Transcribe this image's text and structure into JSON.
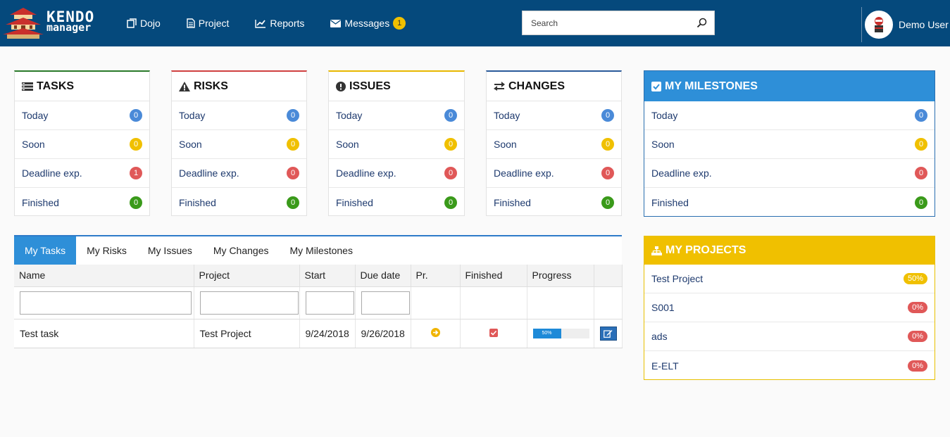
{
  "brand": {
    "line1": "KENDO",
    "line2": "manager"
  },
  "nav": [
    {
      "label": "Dojo",
      "icon": "dojo-icon"
    },
    {
      "label": "Project",
      "icon": "document-icon"
    },
    {
      "label": "Reports",
      "icon": "chart-line-icon"
    },
    {
      "label": "Messages",
      "icon": "envelope-icon",
      "badge": "1"
    }
  ],
  "search": {
    "placeholder": "Search",
    "value": ""
  },
  "user": {
    "name": "Demo User"
  },
  "cards": [
    {
      "title": "TASKS",
      "icon": "tasks-icon",
      "accent": "#2a7a2a",
      "rows": [
        {
          "label": "Today",
          "count": "0",
          "color": "blue"
        },
        {
          "label": "Soon",
          "count": "0",
          "color": "yellow"
        },
        {
          "label": "Deadline exp.",
          "count": "1",
          "color": "red"
        },
        {
          "label": "Finished",
          "count": "0",
          "color": "green"
        }
      ]
    },
    {
      "title": "RISKS",
      "icon": "warning-icon",
      "accent": "#d04040",
      "rows": [
        {
          "label": "Today",
          "count": "0",
          "color": "blue"
        },
        {
          "label": "Soon",
          "count": "0",
          "color": "yellow"
        },
        {
          "label": "Deadline exp.",
          "count": "0",
          "color": "red"
        },
        {
          "label": "Finished",
          "count": "0",
          "color": "green"
        }
      ]
    },
    {
      "title": "ISSUES",
      "icon": "exclamation-circle-icon",
      "accent": "#e8b800",
      "rows": [
        {
          "label": "Today",
          "count": "0",
          "color": "blue"
        },
        {
          "label": "Soon",
          "count": "0",
          "color": "yellow"
        },
        {
          "label": "Deadline exp.",
          "count": "0",
          "color": "red"
        },
        {
          "label": "Finished",
          "count": "0",
          "color": "green"
        }
      ]
    },
    {
      "title": "CHANGES",
      "icon": "exchange-icon",
      "accent": "#2a5a9a",
      "rows": [
        {
          "label": "Today",
          "count": "0",
          "color": "blue"
        },
        {
          "label": "Soon",
          "count": "0",
          "color": "yellow"
        },
        {
          "label": "Deadline exp.",
          "count": "0",
          "color": "red"
        },
        {
          "label": "Finished",
          "count": "0",
          "color": "green"
        }
      ]
    }
  ],
  "milestones": {
    "title": "MY MILESTONES",
    "icon": "checkbox-icon",
    "rows": [
      {
        "label": "Today",
        "count": "0",
        "color": "blue"
      },
      {
        "label": "Soon",
        "count": "0",
        "color": "yellow"
      },
      {
        "label": "Deadline exp.",
        "count": "0",
        "color": "red"
      },
      {
        "label": "Finished",
        "count": "0",
        "color": "green"
      }
    ]
  },
  "projects": {
    "title": "MY PROJECTS",
    "icon": "sitemap-icon",
    "rows": [
      {
        "label": "Test Project",
        "pct": "50%",
        "color": "#f0c000"
      },
      {
        "label": "S001",
        "pct": "0%",
        "color": "#e05858"
      },
      {
        "label": "ads",
        "pct": "0%",
        "color": "#e05858"
      },
      {
        "label": "E-ELT",
        "pct": "0%",
        "color": "#e05858"
      }
    ]
  },
  "tabs": [
    "My Tasks",
    "My Risks",
    "My Issues",
    "My Changes",
    "My Milestones"
  ],
  "grid": {
    "columns": [
      "Name",
      "Project",
      "Start",
      "Due date",
      "Pr.",
      "Finished",
      "Progress",
      ""
    ],
    "rows": [
      {
        "name": "Test task",
        "project": "Test Project",
        "start": "9/24/2018",
        "due": "9/26/2018",
        "priority_icon": "arrow-right-circle-icon",
        "finished_icon": "checked-checkbox-icon",
        "progress": 50,
        "progress_label": "50%"
      }
    ]
  },
  "colors": {
    "topbar": "#05497c",
    "accent_blue": "#2e8fd8",
    "accent_yellow": "#f0c000"
  }
}
